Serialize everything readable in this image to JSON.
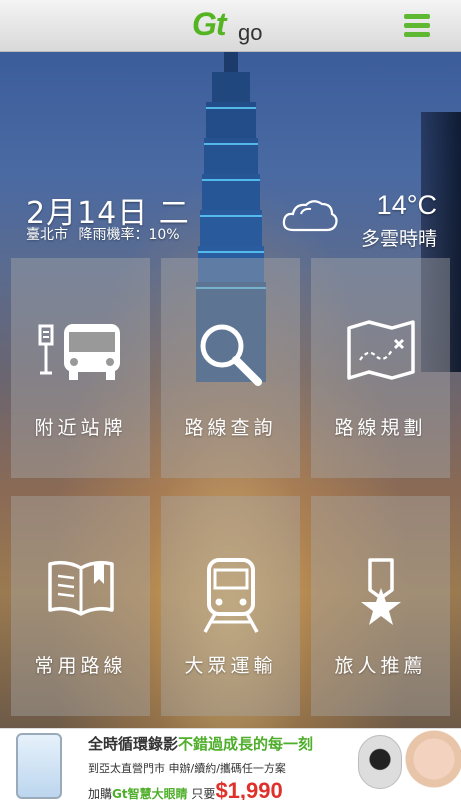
{
  "header": {
    "logo_main": "Gt",
    "logo_sub": "go",
    "menu_icon": "hamburger-menu-icon"
  },
  "info": {
    "date": "2月14日 二",
    "city": "臺北市",
    "rain_label": "降雨機率：10%",
    "weather_icon": "cloud-icon",
    "temperature": "14°C",
    "condition": "多雲時晴"
  },
  "tiles": [
    {
      "label": "附近站牌",
      "icon": "bus-stop-icon"
    },
    {
      "label": "路線查詢",
      "icon": "search-icon"
    },
    {
      "label": "路線規劃",
      "icon": "map-route-icon"
    },
    {
      "label": "常用路線",
      "icon": "book-icon"
    },
    {
      "label": "大眾運輸",
      "icon": "train-icon"
    },
    {
      "label": "旅人推薦",
      "icon": "star-ribbon-icon"
    }
  ],
  "ad": {
    "line1_a": "全時循環錄影",
    "line1_b": "不錯過成長的每一刻",
    "line2": "到亞太直營門市 申辦/續約/攜碼任一方案",
    "line3_a": "加購",
    "line3_brand": "Gt智慧大眼睛",
    "line3_b": " 只要",
    "line3_price": "$1,990"
  },
  "colors": {
    "brand_green": "#55b422",
    "price_red": "#e0302a"
  }
}
